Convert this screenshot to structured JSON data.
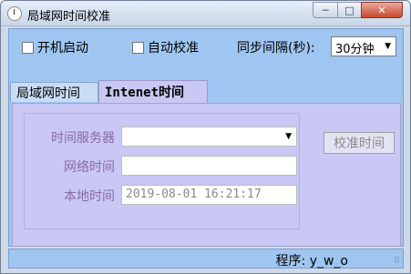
{
  "window": {
    "title": "局域网时间校准",
    "min_glyph": "─",
    "max_glyph": "□",
    "close_glyph": "✕"
  },
  "options": {
    "autostart_label": "开机启动",
    "autosync_label": "自动校准",
    "interval_label": "同步间隔(秒):",
    "interval_value": "30分钟",
    "arrow_glyph": "▼"
  },
  "tabs": [
    {
      "label": "局域网时间"
    },
    {
      "label": "Intenet时间"
    }
  ],
  "form": {
    "server_label": "时间服务器",
    "server_value": "",
    "network_label": "网络时间",
    "network_value": "",
    "local_label": "本地时间",
    "local_value": "2019-08-01 16:21:17",
    "sync_button": "校准时间"
  },
  "status": {
    "text": "程序: y_w_o",
    "grip": "⠿"
  }
}
